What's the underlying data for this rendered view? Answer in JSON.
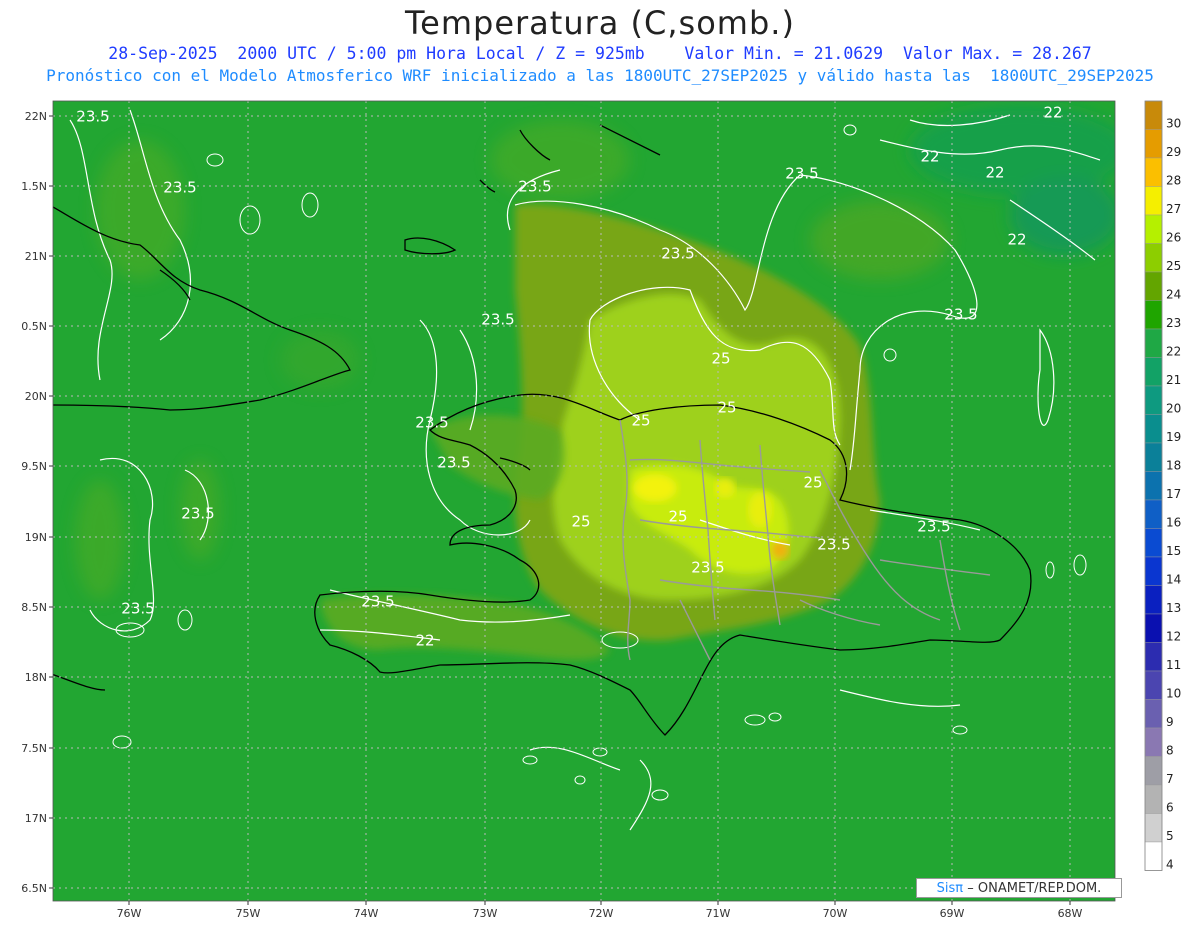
{
  "header": {
    "title": "Temperatura (C,somb.)",
    "line1": "28-Sep-2025  2000 UTC / 5:00 pm Hora Local / Z = 925mb    Valor Min. = 21.0629  Valor Max. = 28.267",
    "line2": "Pronóstico con el Modelo Atmosferico WRF inicializado a las 1800UTC_27SEP2025 y válido hasta las  1800UTC_29SEP2025"
  },
  "map": {
    "lon_range": [
      -76.65,
      -67.6
    ],
    "lat_range": [
      16.4,
      22.1
    ],
    "lon_ticks": [
      "76W",
      "75W",
      "74W",
      "73W",
      "72W",
      "71W",
      "70W",
      "69W",
      "68W"
    ],
    "lat_ticks": [
      "22N",
      "1.5N",
      "21N",
      "0.5N",
      "20N",
      "9.5N",
      "19N",
      "8.5N",
      "18N",
      "7.5N",
      "17N",
      "6.5N"
    ],
    "contour_labels": [
      "23.5",
      "23.5",
      "23.5",
      "23.5",
      "23.5",
      "23.5",
      "23.5",
      "23.5",
      "23.5",
      "23.5",
      "23.5",
      "23.5",
      "23.5",
      "23.5",
      "23.5",
      "25",
      "25",
      "25",
      "25",
      "25",
      "25",
      "22",
      "22",
      "22",
      "22",
      "22"
    ],
    "colors": {
      "base_green": "#22a632",
      "land_green": "#7ba71a",
      "warm_green": "#9ed11a",
      "yellow": "#f3f20a",
      "orange": "#f0b00a"
    }
  },
  "legend": {
    "labels": [
      "30",
      "29",
      "28",
      "27",
      "26",
      "25",
      "24",
      "23",
      "22",
      "21",
      "20",
      "19",
      "18",
      "17",
      "16",
      "15",
      "14",
      "13",
      "12",
      "11",
      "10",
      "9",
      "8",
      "7",
      "6",
      "5",
      "4"
    ],
    "colors": [
      "#c88a0a",
      "#e59c00",
      "#fbbf00",
      "#f5ef00",
      "#b5f000",
      "#8dce00",
      "#63a500",
      "#1fa500",
      "#1fa845",
      "#12a266",
      "#0e9a80",
      "#0a8e8e",
      "#0b8099",
      "#0c72ae",
      "#0f5fc6",
      "#0a4bd2",
      "#0a36d0",
      "#0a20c0",
      "#0a10b0",
      "#2c2cb0",
      "#4b45b0",
      "#6a60b0",
      "#8a78b2",
      "#9e9ea6",
      "#b3b3b3",
      "#d0d0d0",
      "#ffffff"
    ]
  },
  "credit": {
    "brand": "Sisπ",
    "text": "– ONAMET/REP.DOM."
  }
}
